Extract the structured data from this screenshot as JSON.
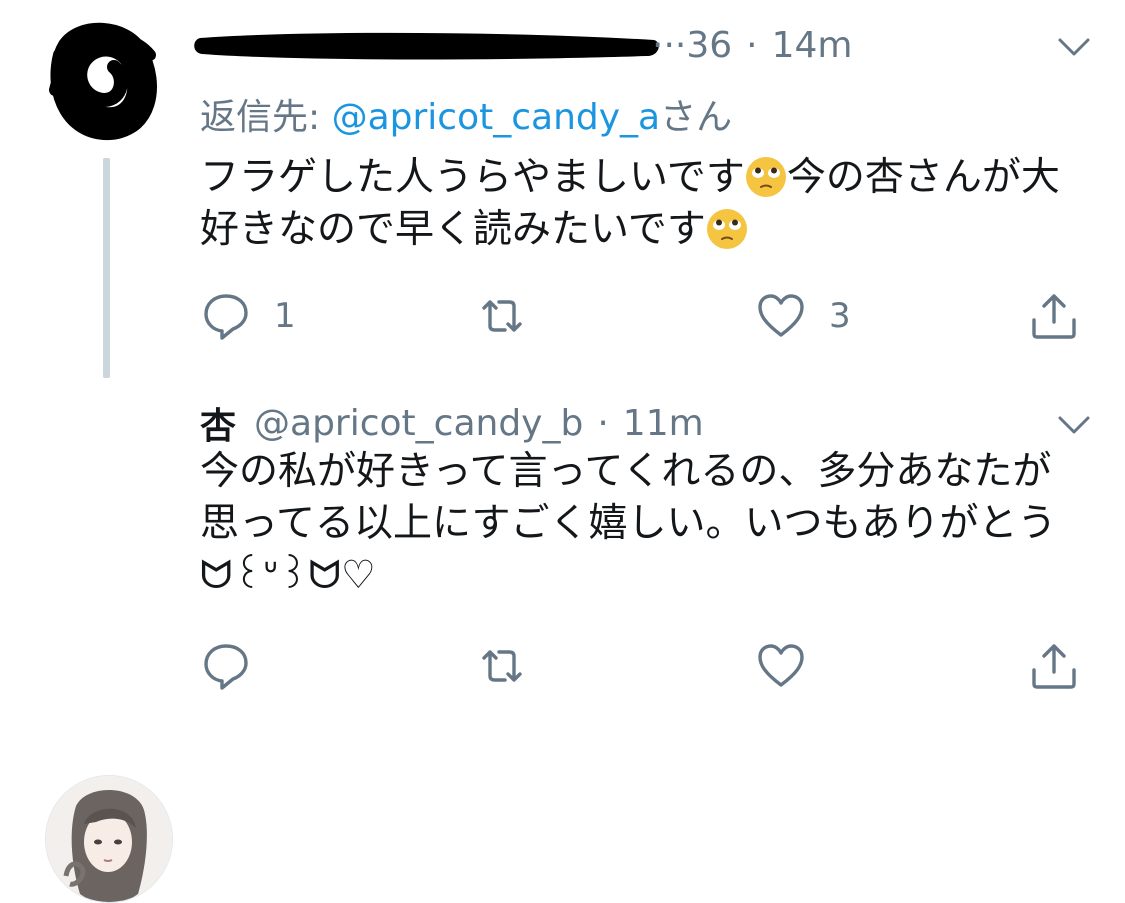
{
  "tweets": [
    {
      "display_name": "",
      "handle_visible": "···36",
      "time": "14m",
      "reply_to_prefix": "返信先: ",
      "reply_to_handle": "@apricot_candy_a",
      "reply_to_suffix": "さん",
      "text_parts": [
        "フラゲした人うらやましいです",
        "今の杏さんが大好きなので早く読みたいです"
      ],
      "emoji": "face-with-pleading-rolling-eyes",
      "replies": "1",
      "retweets": "",
      "likes": "3"
    },
    {
      "display_name": "杏",
      "handle": "@apricot_candy_b",
      "time": "11m",
      "text": "今の私が好きって言ってくれるの、多分あなたが思ってる以上にすごく嬉しい。いつもありがとう",
      "text_tail": "ᗢ꒰ᐡ꒱ᗢ♡",
      "replies": "",
      "retweets": "",
      "likes": ""
    }
  ],
  "dot_separator": "·",
  "icons": [
    "chevron-down-icon",
    "reply-icon",
    "retweet-icon",
    "like-icon",
    "share-icon"
  ],
  "colors": {
    "muted": "#657786",
    "mention": "#1b95e0",
    "thread_line": "#ccd6dd",
    "text": "#14171a"
  }
}
